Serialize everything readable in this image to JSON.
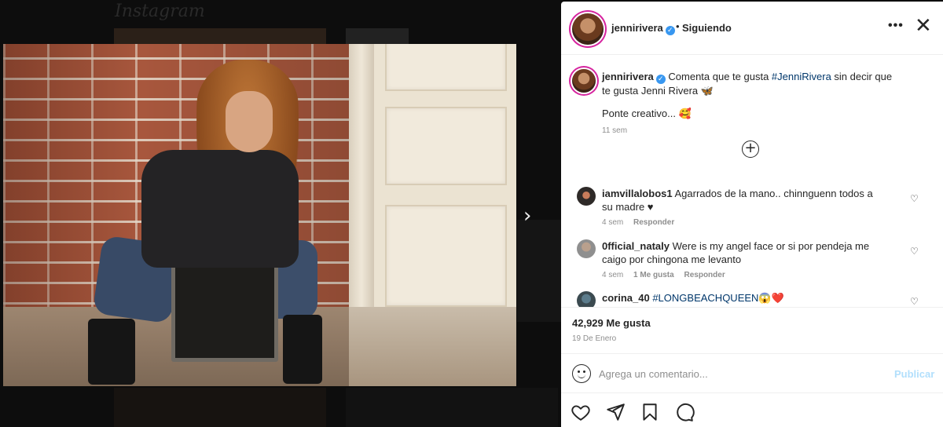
{
  "background": {
    "logo_text": "Instagram"
  },
  "post": {
    "username": "jennirivera",
    "follow_status": "Siguiendo",
    "more_label": "•••",
    "caption": {
      "username": "jennirivera",
      "text_before": "Comenta que te gusta ",
      "hashtag": "#JenniRivera",
      "text_after": " sin decir que te gusta Jenni Rivera 🦋",
      "line2": "Ponte creativo... 🥰",
      "time": "11 sem"
    },
    "comments": [
      {
        "username": "iamvillalobos1",
        "text": "Agarrados de la mano.. chinnguenn todos a su madre ♥",
        "time": "4 sem",
        "likes": "",
        "reply": "Responder"
      },
      {
        "username": "0fficial_nataly",
        "text": "Were is my angel face or si por pendeja me caigo por chingona me levanto",
        "time": "4 sem",
        "likes": "1 Me gusta",
        "reply": "Responder"
      },
      {
        "username": "corina_40",
        "text": "#LONGBEACHQUEEN😱❤️",
        "time": "",
        "likes": "",
        "reply": ""
      }
    ],
    "likes_count": "42,929 Me gusta",
    "date": "19 De Enero",
    "comment_placeholder": "Agrega un comentario...",
    "publish_label": "Publicar"
  },
  "colors": {
    "accent": "#0095f6",
    "publish_disabled": "#b2dffc",
    "verified": "#3897f0",
    "hashtag": "#00376b"
  },
  "icons": [
    "verified-icon",
    "close-icon",
    "more-icon",
    "next-arrow-icon",
    "add-circle-icon",
    "heart-icon",
    "share-icon",
    "bookmark-icon",
    "comment-icon",
    "emoji-icon"
  ]
}
